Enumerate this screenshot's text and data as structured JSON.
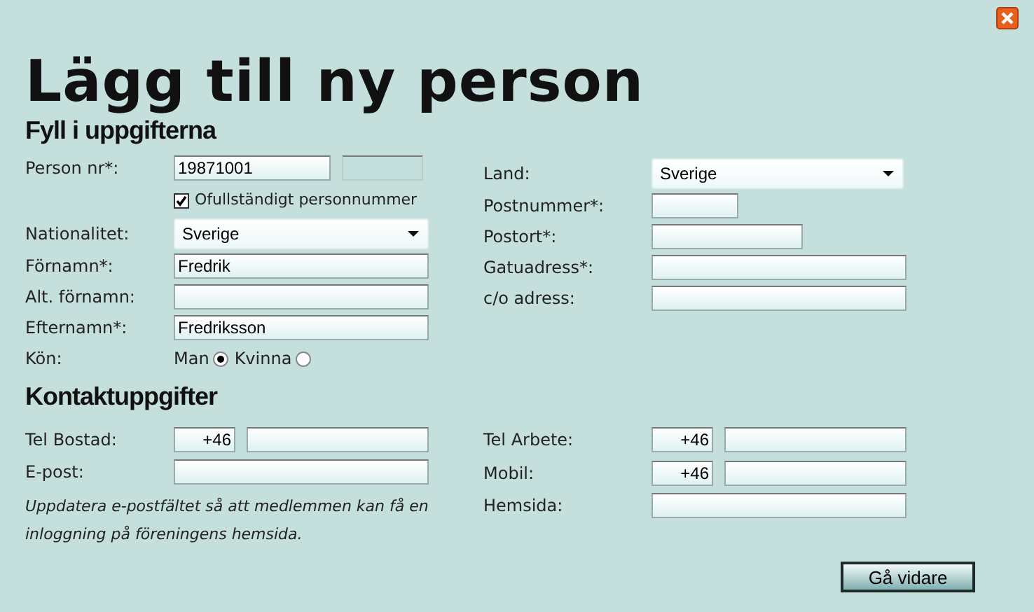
{
  "title": "Lägg till ny person",
  "person_section": {
    "heading": "Fyll i uppgifterna",
    "left_rows": [
      {
        "kind": "pair",
        "label": "Person nr*:",
        "value": "19871001",
        "second_disabled": true
      },
      {
        "kind": "checkbox",
        "text": "Ofullständigt personnummer",
        "checked": true
      },
      {
        "kind": "select",
        "label": "Nationalitet:",
        "value": "Sverige"
      },
      {
        "kind": "text",
        "label": "Förnamn*:",
        "value": "Fredrik"
      },
      {
        "kind": "text",
        "label": "Alt. förnamn:"
      },
      {
        "kind": "text",
        "label": "Efternamn*:",
        "value": "Fredriksson"
      },
      {
        "kind": "radio",
        "label": "Kön:",
        "options": [
          {
            "label": "Man",
            "selected": true
          },
          {
            "label": "Kvinna",
            "selected": false
          }
        ]
      }
    ],
    "right_rows": [
      {
        "kind": "select",
        "label": "Land:",
        "value": "Sverige"
      },
      {
        "kind": "text",
        "label": "Postnummer*:"
      },
      {
        "kind": "text",
        "label": "Postort*:"
      },
      {
        "kind": "text",
        "label": "Gatuadress*:"
      },
      {
        "kind": "text",
        "label": "c/o adress:"
      }
    ]
  },
  "contact_section": {
    "heading": "Kontaktuppgifter",
    "left_rows": [
      {
        "kind": "phone",
        "label": "Tel Bostad:",
        "prefix": "+46"
      },
      {
        "kind": "text",
        "label": "E-post:"
      },
      {
        "kind": "note",
        "text": "Uppdatera e-postfältet så att medlemmen kan få en inloggning på föreningens hemsida."
      }
    ],
    "right_rows": [
      {
        "kind": "phone",
        "label": "Tel Arbete:",
        "prefix": "+46"
      },
      {
        "kind": "phone",
        "label": "Mobil:",
        "prefix": "+46"
      },
      {
        "kind": "text",
        "label": "Hemsida:"
      }
    ]
  },
  "buttons": [
    "Gå vidare"
  ]
}
